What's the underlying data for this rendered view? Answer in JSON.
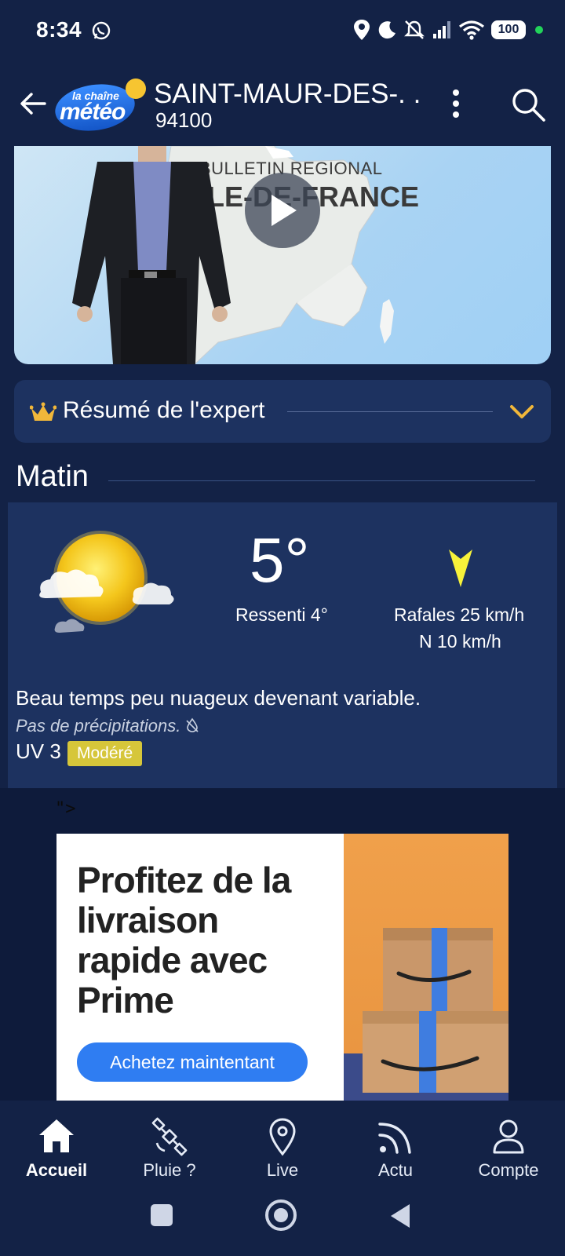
{
  "status_bar": {
    "time": "8:34",
    "battery": "100",
    "icons": [
      "whatsapp-icon",
      "location-icon",
      "moon-icon",
      "mute-icon",
      "signal-icon",
      "wifi-icon",
      "battery-icon"
    ]
  },
  "header": {
    "logo_small": "la chaîne",
    "logo_big": "météo",
    "city": "SAINT-MAUR-DES-. .",
    "postcode": "94100",
    "icons": [
      "back-arrow-icon",
      "more-vert-icon",
      "search-icon"
    ]
  },
  "video": {
    "line1": "BULLETIN REGIONAL",
    "line2": "ÎLE-DE-FRANCE"
  },
  "expert": {
    "label": "Résumé de l'expert",
    "icons": [
      "crown-icon",
      "chevron-down-icon"
    ]
  },
  "matin": {
    "title": "Matin",
    "temperature": "5°",
    "ressenti": "Ressenti 4°",
    "rafales": "Rafales 25 km/h",
    "wind": "N 10 km/h",
    "description": "Beau temps peu nuageux devenant variable.",
    "precipitation": "Pas de précipitations.",
    "uv_label": "UV 3",
    "uv_level": "Modéré"
  },
  "ad": {
    "stray_text": "\">",
    "headline": "Profitez de la livraison rapide avec Prime",
    "cta": "Achetez maintentant"
  },
  "bottom_nav": {
    "items": [
      {
        "label": "Accueil",
        "icon": "home-icon"
      },
      {
        "label": "Pluie ?",
        "icon": "satellite-icon"
      },
      {
        "label": "Live",
        "icon": "location-pin-icon"
      },
      {
        "label": "Actu",
        "icon": "feed-icon"
      },
      {
        "label": "Compte",
        "icon": "account-icon"
      }
    ]
  },
  "colors": {
    "background": "#132246",
    "card": "#1d3260",
    "accent_yellow": "#f7c531",
    "uv_badge": "#d6c63a",
    "cta_blue": "#2f7df2"
  }
}
